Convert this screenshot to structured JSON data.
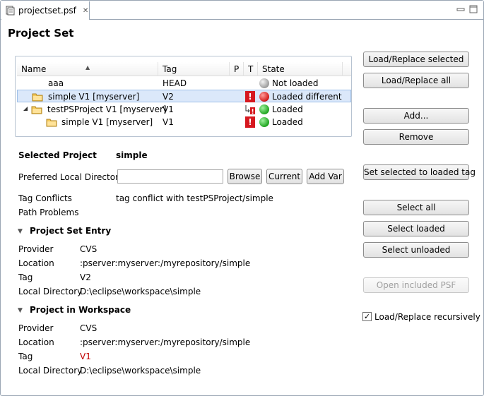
{
  "editor": {
    "tab_title": "projectset.psf"
  },
  "form": {
    "title": "Project Set"
  },
  "table": {
    "columns": [
      "Name",
      "Tag",
      "P",
      "T",
      "State"
    ],
    "rows": [
      {
        "name": "aaa",
        "tag": "HEAD",
        "state": "Not loaded"
      },
      {
        "name": "simple  V1 [myserver]",
        "tag": "V2",
        "state": "Loaded different"
      },
      {
        "name": "testPSProject  V1 [myserver]",
        "tag": "V1",
        "state": "Loaded"
      },
      {
        "name": "simple  V1 [myserver]",
        "tag": "V1",
        "state": "Loaded"
      }
    ]
  },
  "details": {
    "selected_project_label": "Selected Project",
    "selected_project_value": "simple",
    "preferred_dir_label": "Preferred Local Directory",
    "preferred_dir_value": "",
    "browse": "Browse",
    "current": "Current",
    "add_var": "Add Var",
    "tag_conflicts_label": "Tag Conflicts",
    "tag_conflicts_value": "tag conflict with  testPSProject/simple",
    "path_problems_label": "Path Problems"
  },
  "entry": {
    "title": "Project Set Entry",
    "provider_label": "Provider",
    "provider": "CVS",
    "location_label": "Location",
    "location": ":pserver:myserver:/myrepository/simple",
    "tag_label": "Tag",
    "tag": "V2",
    "local_dir_label": "Local Directory",
    "local_dir": "D:\\eclipse\\workspace\\simple"
  },
  "workspace": {
    "title": "Project in Workspace",
    "provider_label": "Provider",
    "provider": "CVS",
    "location_label": "Location",
    "location": ":pserver:myserver:/myrepository/simple",
    "tag_label": "Tag",
    "tag": "V1",
    "local_dir_label": "Local Directory",
    "local_dir": "D:\\eclipse\\workspace\\simple"
  },
  "buttons": {
    "load_replace_selected": "Load/Replace selected",
    "load_replace_all": "Load/Replace all",
    "add": "Add...",
    "remove": "Remove",
    "set_selected_to_loaded_tag": "Set selected to loaded tag",
    "select_all": "Select all",
    "select_loaded": "Select loaded",
    "select_unloaded": "Select unloaded",
    "open_included_psf": "Open included PSF",
    "load_replace_recursively": "Load/Replace recursively"
  },
  "colors": {
    "conflict_tag": "#c00000",
    "selection": "#dbe8fa"
  }
}
